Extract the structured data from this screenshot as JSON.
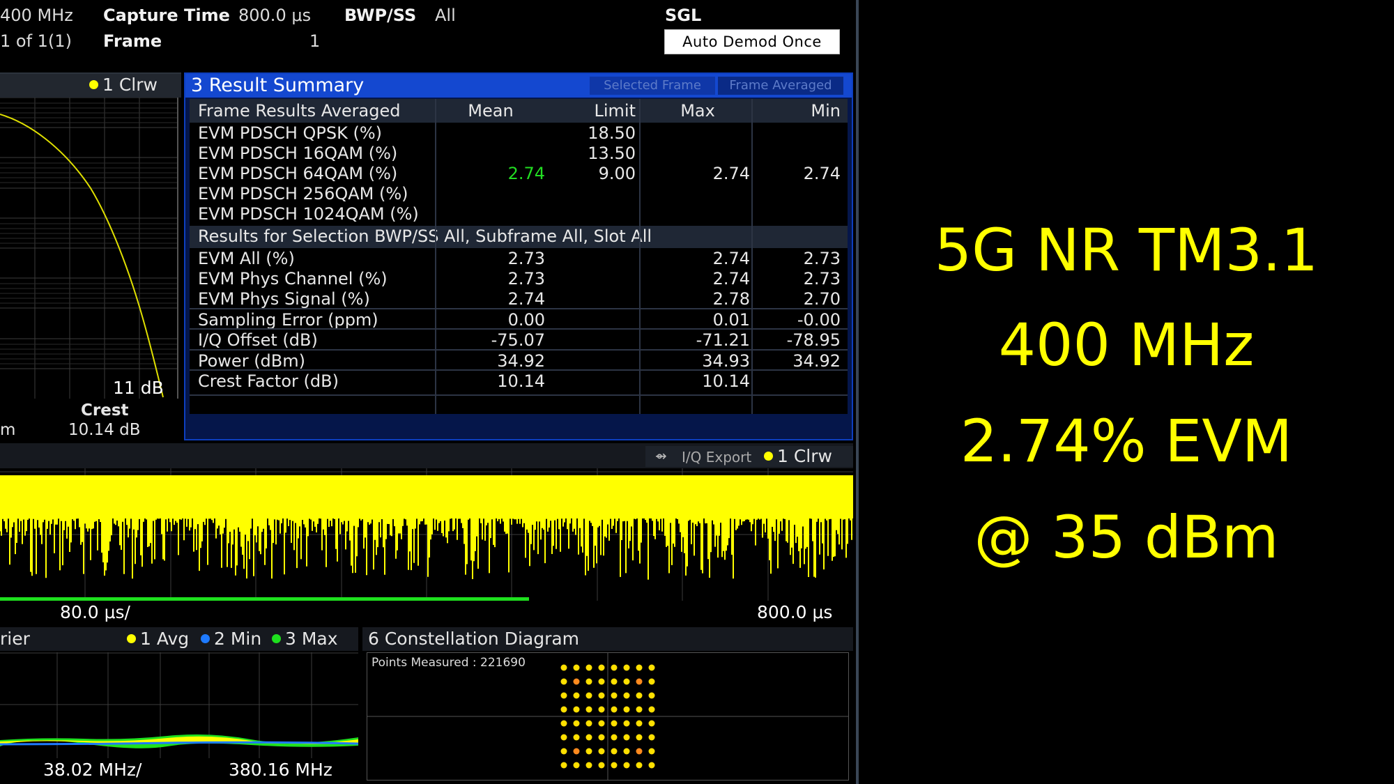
{
  "header": {
    "bandwidth": "400 MHz",
    "capture_time_label": "Capture Time",
    "capture_time_value": "800.0 μs",
    "bwp_ss_label": "BWP/SS",
    "bwp_ss_value": "All",
    "sgl": "SGL",
    "frame_count": "1 of 1(1)",
    "frame_label": "Frame",
    "frame_value": "1",
    "auto_demod_label": "Auto Demod Once"
  },
  "ccdf": {
    "trace_label": "1 Clrw",
    "x_end_label": "11 dB",
    "crest_label": "Crest",
    "crest_value": "10.14 dB",
    "cut_label": "m"
  },
  "result_summary": {
    "title": "3 Result Summary",
    "tab_selected": "Selected Frame",
    "tab_averaged": "Frame Averaged",
    "columns": [
      "Frame Results Averaged",
      "Mean",
      "Limit",
      "Max",
      "Min"
    ],
    "frame_rows": [
      {
        "label": "EVM PDSCH QPSK (%)",
        "mean": "",
        "limit": "18.50",
        "max": "",
        "min": ""
      },
      {
        "label": "EVM PDSCH 16QAM (%)",
        "mean": "",
        "limit": "13.50",
        "max": "",
        "min": ""
      },
      {
        "label": "EVM PDSCH 64QAM (%)",
        "mean": "2.74",
        "limit": "9.00",
        "max": "2.74",
        "min": "2.74"
      },
      {
        "label": "EVM PDSCH 256QAM (%)",
        "mean": "",
        "limit": "",
        "max": "",
        "min": ""
      },
      {
        "label": "EVM PDSCH 1024QAM (%)",
        "mean": "",
        "limit": "",
        "max": "",
        "min": ""
      }
    ],
    "selection_header": "Results for Selection  BWP/SS All,  Subframe All,  Slot All",
    "selection_rows": [
      {
        "label": "EVM All (%)",
        "mean": "2.73",
        "max": "2.74",
        "min": "2.73"
      },
      {
        "label": "EVM Phys Channel (%)",
        "mean": "2.73",
        "max": "2.74",
        "min": "2.73"
      },
      {
        "label": "EVM Phys Signal (%)",
        "mean": "2.74",
        "max": "2.78",
        "min": "2.70"
      },
      {
        "label": "Sampling Error (ppm)",
        "mean": "0.00",
        "max": "0.01",
        "min": "-0.00"
      },
      {
        "label": "I/Q Offset (dB)",
        "mean": "-75.07",
        "max": "-71.21",
        "min": "-78.95"
      },
      {
        "label": "Power (dBm)",
        "mean": "34.92",
        "max": "34.93",
        "min": "34.92"
      },
      {
        "label": "Crest Factor (dB)",
        "mean": "10.14",
        "max": "10.14",
        "min": ""
      }
    ],
    "mean_highlight_color": "#22dd22"
  },
  "time_domain": {
    "iq_export": "I/Q Export",
    "trace_label": "1 Clrw",
    "x_div": "80.0 μs/",
    "x_end": "800.0 μs",
    "progress_fraction": 0.62
  },
  "spectrum": {
    "title_fragment": "rier",
    "trace1": "1 Avg",
    "trace2": "2 Min",
    "trace3": "3 Max",
    "x_div": "38.02 MHz/",
    "x_end": "380.16 MHz"
  },
  "constellation": {
    "title": "6 Constellation Diagram",
    "points_label": "Points Measured : 221690"
  },
  "overlay": {
    "line1": "5G NR TM3.1",
    "line2": "400 MHz",
    "line3": "2.74% EVM",
    "line4": "@ 35 dBm"
  }
}
